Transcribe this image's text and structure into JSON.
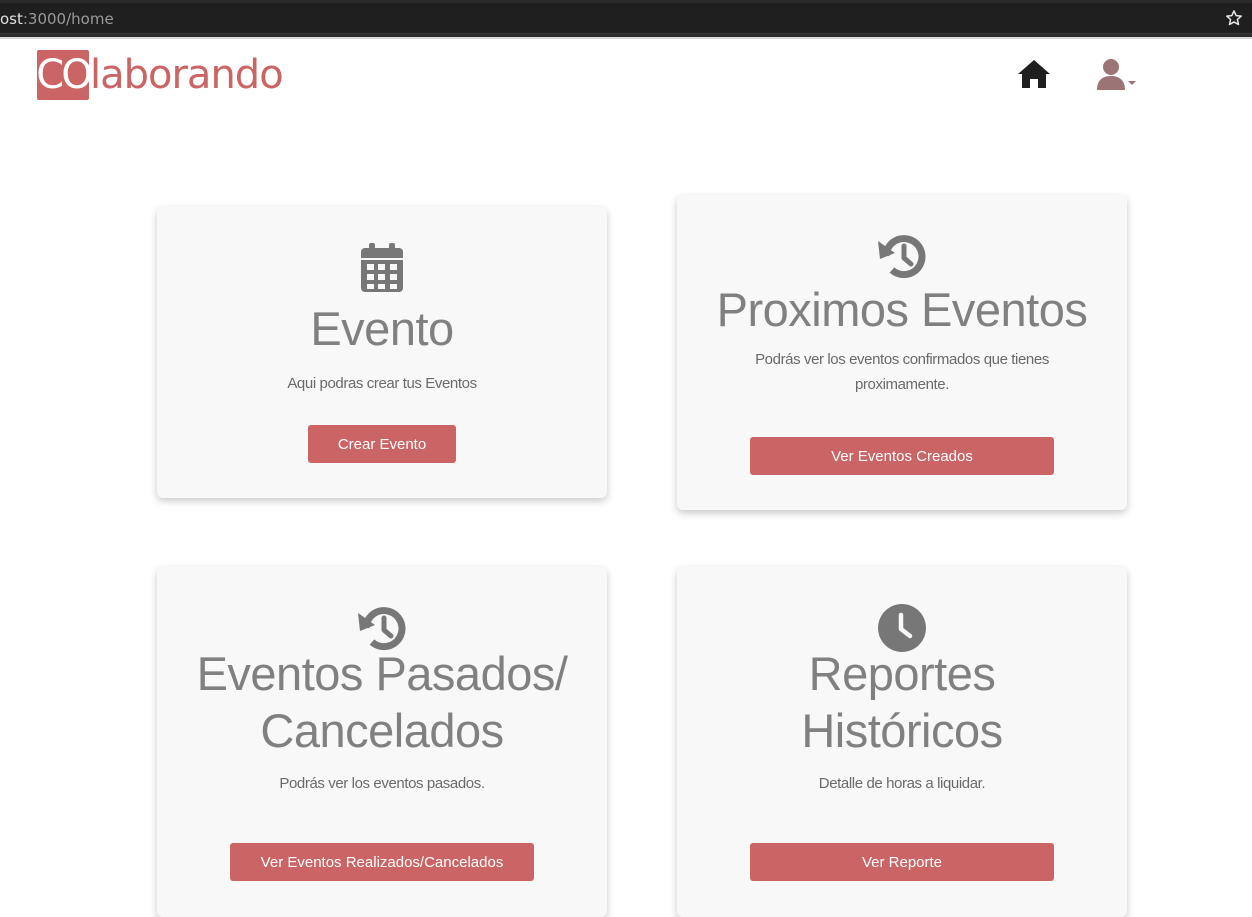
{
  "browser": {
    "url_host": "ost",
    "url_path": ":3000/home"
  },
  "navbar": {
    "logo_box": "CO",
    "logo_rest": "laborando",
    "icons": [
      "home-icon",
      "user-icon",
      "caret-down-icon"
    ]
  },
  "colors": {
    "brand": "#cb6464",
    "card_bg": "#f8f8f8",
    "text_gray": "#808080"
  },
  "cards": [
    {
      "icon": "calendar-icon",
      "title": "Evento",
      "text": "Aqui podras crear tus Eventos",
      "button": "Crear Evento"
    },
    {
      "icon": "history-icon",
      "title": "Proximos Eventos",
      "text_line1": "Podrás ver los eventos confirmados que tienes",
      "text_line2": "proximamente.",
      "button": "Ver Eventos Creados"
    },
    {
      "icon": "history-icon",
      "title_line1": "Eventos Pasados/",
      "title_line2": "Cancelados",
      "text": "Podrás ver los eventos pasados.",
      "button": "Ver Eventos Realizados/Cancelados"
    },
    {
      "icon": "clock-icon",
      "title_line1": "Reportes",
      "title_line2": "Históricos",
      "text": "Detalle de horas a liquidar.",
      "button": "Ver Reporte"
    }
  ]
}
